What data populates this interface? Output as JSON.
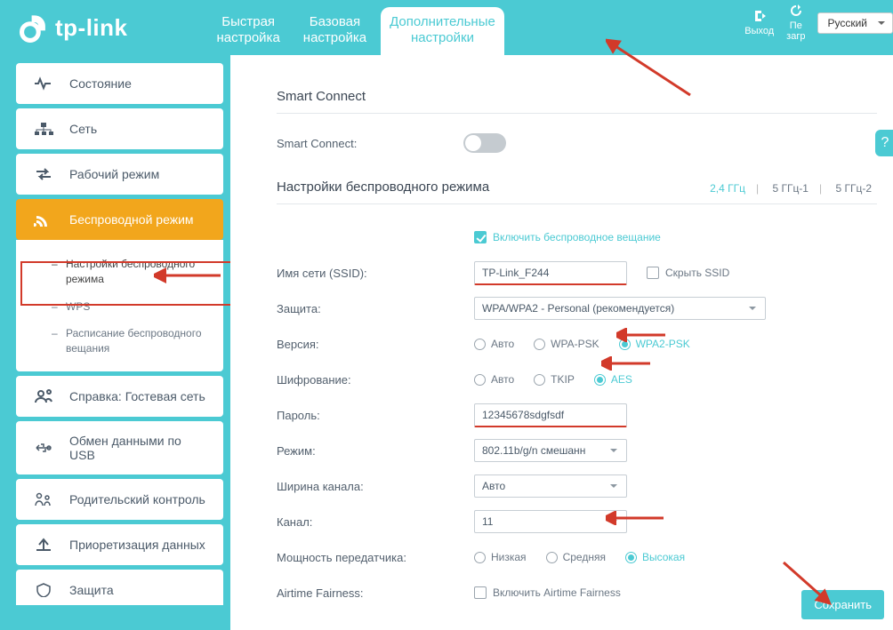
{
  "brand": "tp-link",
  "topTabs": {
    "quick": "Быстрая\nнастройка",
    "basic": "Базовая\nнастройка",
    "advanced": "Дополнительные\nнастройки"
  },
  "topRight": {
    "logout": "Выход",
    "reboot": "Пе\nзагр",
    "lang": "Русский"
  },
  "nav": {
    "status": "Состояние",
    "network": "Сеть",
    "opmode": "Рабочий режим",
    "wireless": "Беспроводной режим",
    "sub": {
      "settings": "Настройки беспроводного режима",
      "wps": "WPS",
      "schedule": "Расписание беспроводного вещания"
    },
    "guest": "Справка: Гостевая сеть",
    "usb": "Обмен данными по USB",
    "parental": "Родительский контроль",
    "qos": "Приоретизация данных",
    "security": "Защита"
  },
  "sections": {
    "smartConnectTitle": "Smart Connect",
    "smartConnectLabel": "Smart Connect:",
    "wirelessTitle": "Настройки беспроводного режима"
  },
  "bandTabs": {
    "g24": "2,4 ГГц",
    "g5a": "5 ГГц-1",
    "g5b": "5 ГГц-2"
  },
  "form": {
    "enableLabel": "Включить беспроводное вещание",
    "ssidLabel": "Имя сети (SSID):",
    "ssidValue": "TP-Link_F244",
    "hideSsid": "Скрыть SSID",
    "securityLabel": "Защита:",
    "securityValue": "WPA/WPA2 - Personal (рекомендуется)",
    "versionLabel": "Версия:",
    "versionOpts": {
      "auto": "Авто",
      "wpa": "WPA-PSK",
      "wpa2": "WPA2-PSK"
    },
    "encryptionLabel": "Шифрование:",
    "encOpts": {
      "auto": "Авто",
      "tkip": "TKIP",
      "aes": "AES"
    },
    "passwordLabel": "Пароль:",
    "passwordValue": "12345678sdgfsdf",
    "modeLabel": "Режим:",
    "modeValue": "802.11b/g/n смешанн",
    "chWidthLabel": "Ширина канала:",
    "chWidthValue": "Авто",
    "channelLabel": "Канал:",
    "channelValue": "11",
    "txPowerLabel": "Мощность передатчика:",
    "txOpts": {
      "low": "Низкая",
      "mid": "Средняя",
      "high": "Высокая"
    },
    "airtimeLabel": "Airtime Fairness:",
    "airtimeOpt": "Включить Airtime Fairness"
  },
  "saveBtn": "Сохранить"
}
